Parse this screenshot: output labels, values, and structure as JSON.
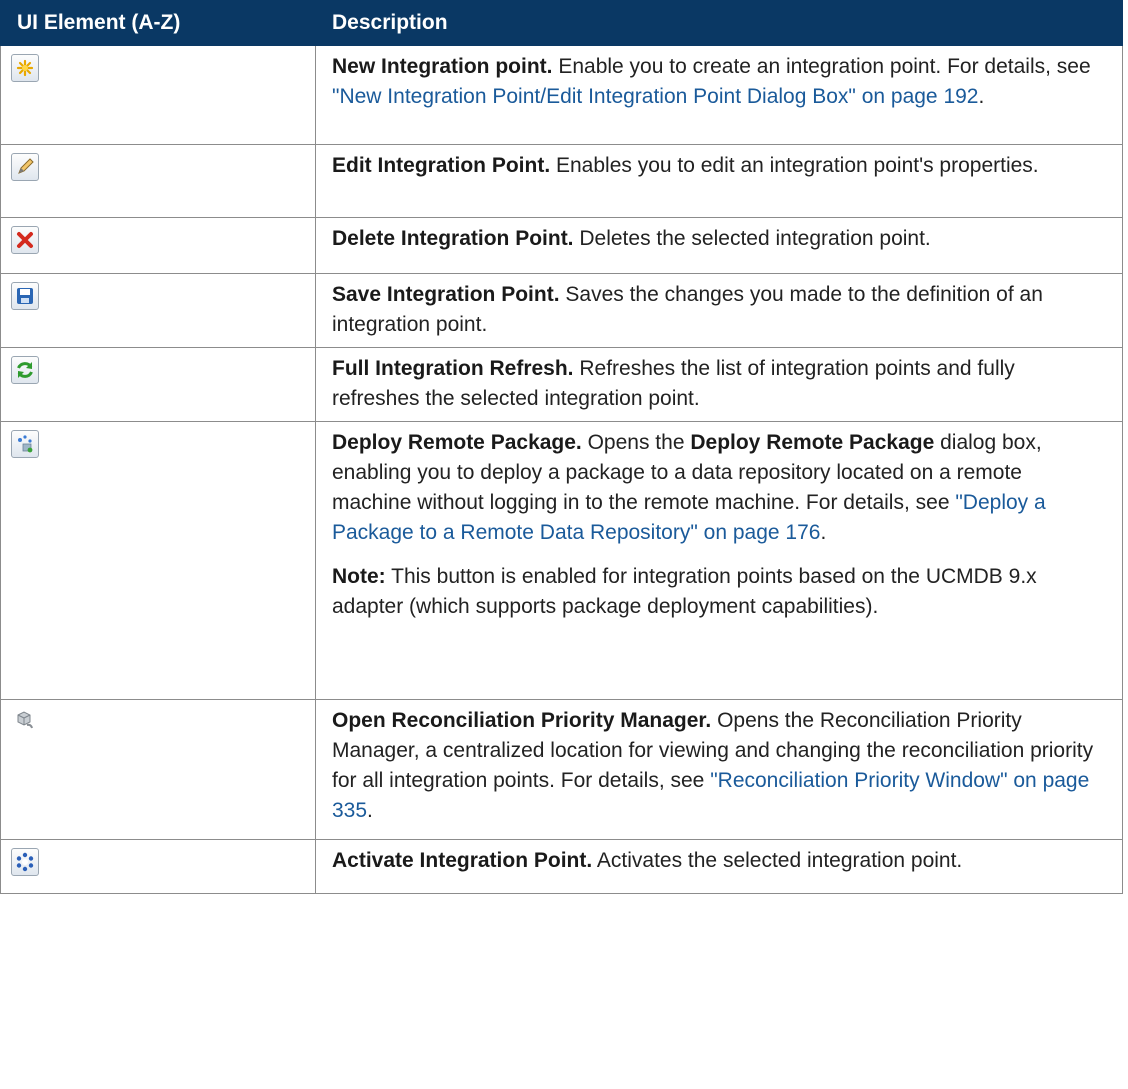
{
  "header": {
    "col1": "UI Element (A-Z)",
    "col2": "Description"
  },
  "rows": [
    {
      "icon": "new-icon",
      "title": "New Integration point.",
      "text": " Enable you to create an integration point. For details, see ",
      "link": "\"New Integration Point/Edit Integration Point Dialog Box\" on page 192",
      "tail": "."
    },
    {
      "icon": "edit-icon",
      "title": "Edit Integration Point.",
      "text": " Enables you to edit an integration point's properties."
    },
    {
      "icon": "delete-icon",
      "title": "Delete Integration Point.",
      "text": " Deletes the selected integration point."
    },
    {
      "icon": "save-icon",
      "title": "Save Integration Point.",
      "text": " Saves the changes you made to the definition of an integration point."
    },
    {
      "icon": "refresh-icon",
      "title": "Full Integration Refresh.",
      "text": " Refreshes the list of integration points and fully refreshes the selected integration point."
    },
    {
      "icon": "deploy-icon",
      "title": "Deploy Remote Package.",
      "text1": " Opens the ",
      "bold2": "Deploy Remote Package",
      "text2": " dialog box, enabling you to deploy a package to a data repository located on a remote machine without logging in to the remote machine. For details, see ",
      "link": "\"Deploy a Package to a Remote Data Repository\" on page 176",
      "tail": ".",
      "note_label": "Note:",
      "note_text": " This button is enabled for integration points based on the UCMDB 9.x adapter (which supports package deployment capabilities)."
    },
    {
      "icon": "reconciliation-icon",
      "title": "Open Reconciliation Priority Manager.",
      "text": " Opens the Reconciliation Priority Manager, a centralized location for viewing and changing the reconciliation priority for all integration points. For details, see ",
      "link": "\"Reconciliation Priority Window\" on page 335",
      "tail": "."
    },
    {
      "icon": "activate-icon",
      "title": "Activate Integration Point.",
      "text": " Activates the selected integration point."
    }
  ]
}
